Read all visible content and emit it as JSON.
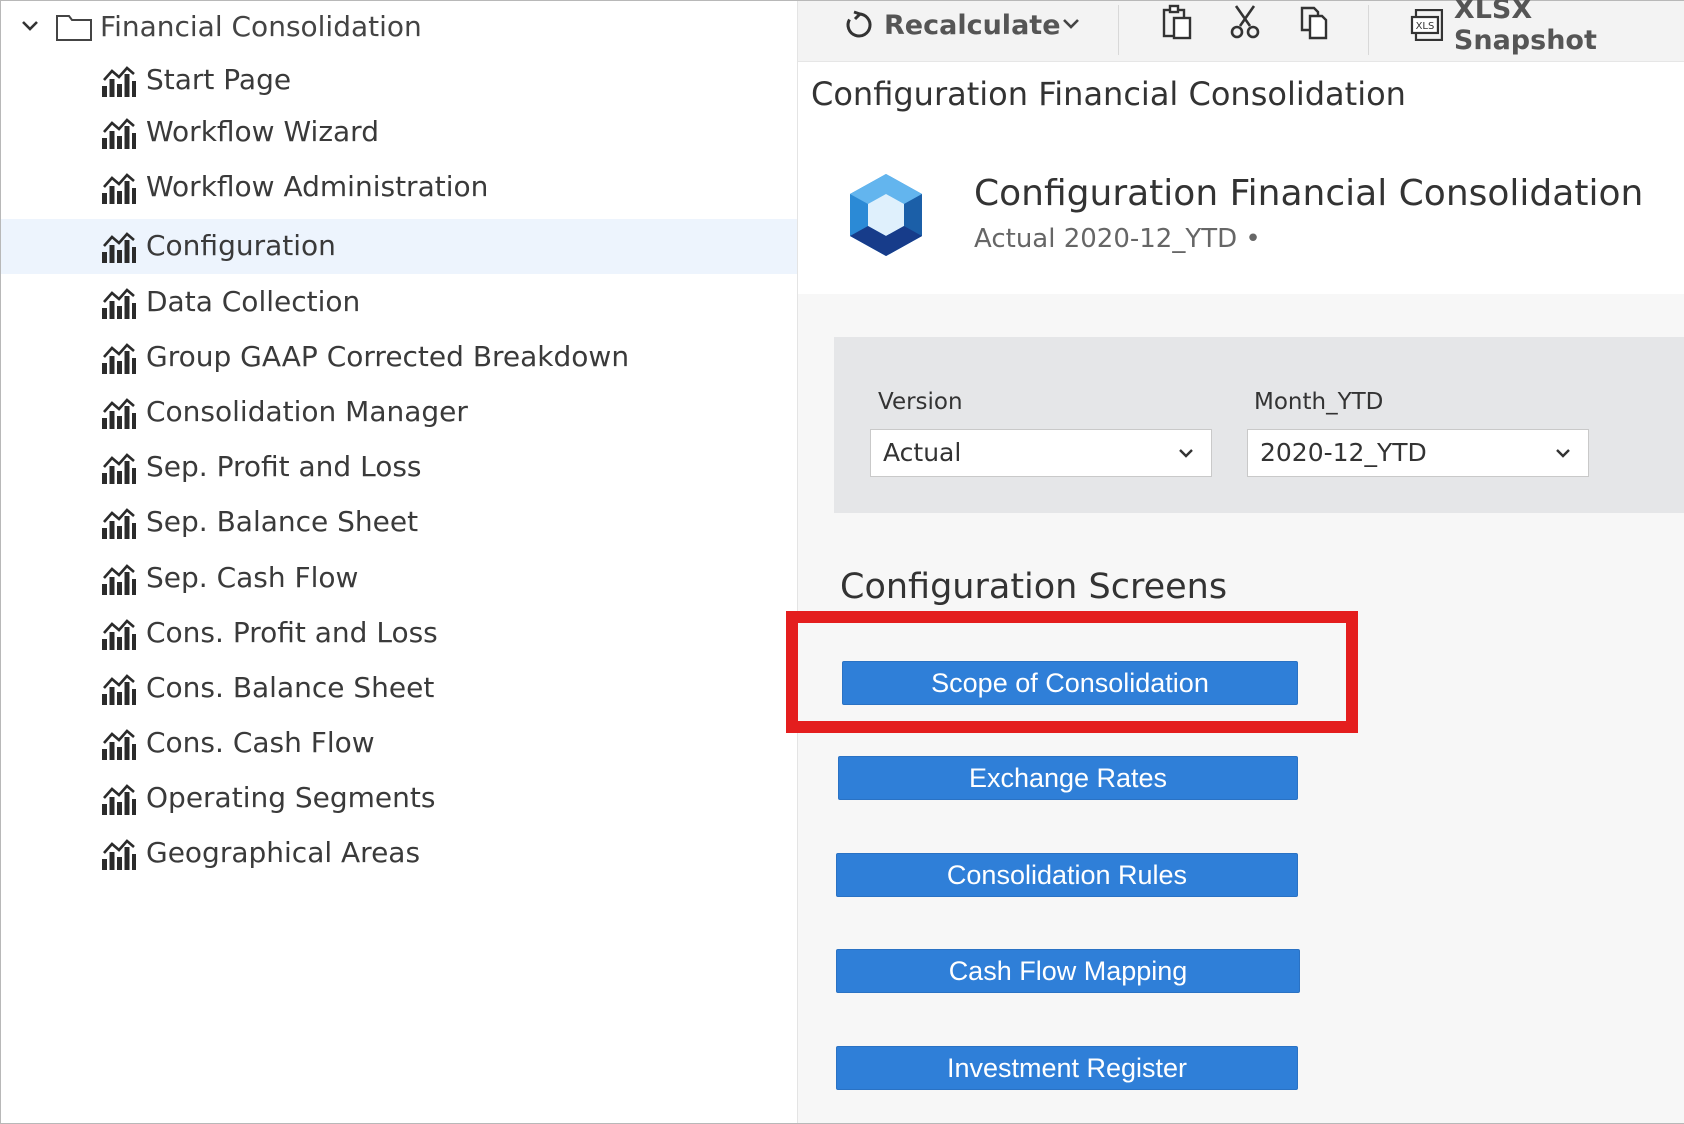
{
  "tree": {
    "root_label": "Financial Consolidation",
    "items": [
      {
        "label": "Start Page",
        "selected": false
      },
      {
        "label": "Workflow Wizard",
        "selected": false
      },
      {
        "label": "Workflow Administration",
        "selected": false
      },
      {
        "label": "Configuration",
        "selected": true
      },
      {
        "label": "Data Collection",
        "selected": false
      },
      {
        "label": "Group GAAP Corrected Breakdown",
        "selected": false
      },
      {
        "label": "Consolidation Manager",
        "selected": false
      },
      {
        "label": "Sep. Profit and Loss",
        "selected": false
      },
      {
        "label": "Sep. Balance Sheet",
        "selected": false
      },
      {
        "label": "Sep. Cash Flow",
        "selected": false
      },
      {
        "label": "Cons. Profit and Loss",
        "selected": false
      },
      {
        "label": "Cons. Balance Sheet",
        "selected": false
      },
      {
        "label": "Cons. Cash Flow",
        "selected": false
      },
      {
        "label": "Operating Segments",
        "selected": false
      },
      {
        "label": "Geographical Areas",
        "selected": false
      }
    ],
    "item_icon": "chart-icon"
  },
  "toolbar": {
    "recalculate_label": "Recalculate",
    "snapshot_label": "XLSX Snapshot",
    "snapshot_icon_text": "XLS"
  },
  "page": {
    "title": "Configuration Financial Consolidation",
    "app_title": "Configuration Financial Consolidation",
    "app_subtitle": "Actual 2020-12_YTD •"
  },
  "filters": {
    "version_label": "Version",
    "version_value": "Actual",
    "month_label": "Month_YTD",
    "month_value": "2020-12_YTD"
  },
  "config": {
    "section_title": "Configuration Screens",
    "buttons": [
      "Scope of Consolidation",
      "Exchange Rates",
      "Consolidation Rules",
      "Cash Flow Mapping",
      "Investment Register"
    ]
  },
  "colors": {
    "button_blue": "#2f7fd8",
    "highlight_red": "#e41e1e",
    "selected_row": "#edf4fd"
  }
}
